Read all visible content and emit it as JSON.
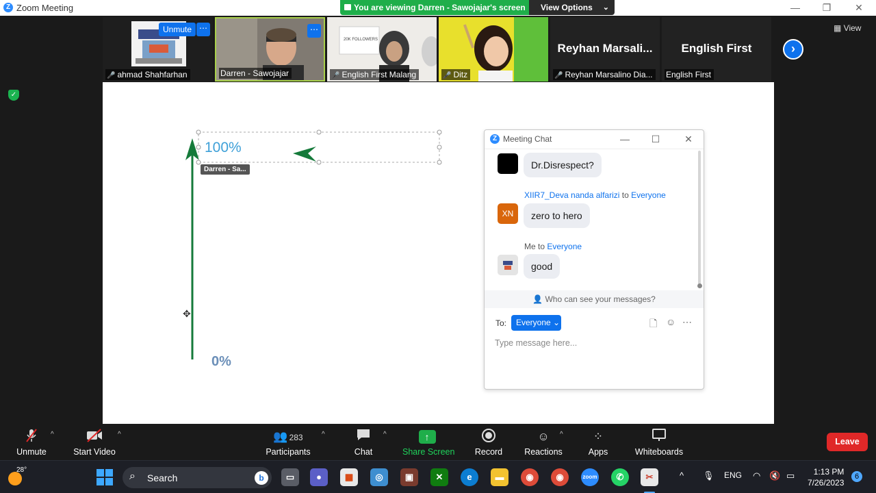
{
  "window": {
    "title": "Zoom Meeting",
    "minimize": "—",
    "restore": "❐",
    "close": "✕"
  },
  "banner": {
    "viewing_text": "You are viewing Darren - Sawojajar's screen",
    "view_options": "View Options"
  },
  "thumbnails": [
    {
      "name": "ahmad Shahfarhan",
      "muted": true,
      "unmute_label": "Unmute"
    },
    {
      "name": "Darren - Sawojajar",
      "muted": false
    },
    {
      "name": "English First Malang",
      "muted": true
    },
    {
      "name": "Ditz",
      "muted": true
    },
    {
      "name": "Reyhan Marsalino Dia...",
      "muted": true,
      "display_name": "Reyhan  Marsali..."
    },
    {
      "name": "English First",
      "muted": false,
      "display_name": "English First"
    }
  ],
  "thumb_overlay": {
    "followers_text": "20K FOLLOWERS"
  },
  "strip": {
    "view_label": "View"
  },
  "share": {
    "top_label": "100%",
    "bottom_label": "0%",
    "annotator_tag": "Darren - Sa..."
  },
  "chat": {
    "title": "Meeting Chat",
    "messages": [
      {
        "text": "Dr.Disrespect?"
      },
      {
        "sender": "XIIR7_Deva nanda alfarizi",
        "to_word": "to",
        "recipient": "Everyone",
        "avatar_initials": "XN",
        "text": "zero to hero"
      },
      {
        "sender": "Me",
        "to_word": "to",
        "recipient": "Everyone",
        "text": "good"
      }
    ],
    "who_can_see": "Who can see your messages?",
    "to_label": "To:",
    "to_value": "Everyone",
    "placeholder": "Type message here..."
  },
  "toolbar": {
    "unmute": "Unmute",
    "start_video": "Start Video",
    "participants": "Participants",
    "participants_count": "283",
    "chat": "Chat",
    "share_screen": "Share Screen",
    "record": "Record",
    "reactions": "Reactions",
    "apps": "Apps",
    "whiteboards": "Whiteboards",
    "leave": "Leave"
  },
  "taskbar": {
    "temperature": "28°",
    "search": "Search",
    "zoom_app_label": "zoom",
    "language": "ENG",
    "time": "1:13 PM",
    "date": "7/26/2023",
    "notifications": "6"
  },
  "colors": {
    "zoom_blue": "#0e72ed",
    "green": "#1fae4a",
    "leave_red": "#e02828",
    "arrow_green": "#157a3a"
  },
  "icons": [
    "mic-muted-icon",
    "video-off-icon",
    "participants-icon",
    "chat-icon",
    "share-screen-icon",
    "record-icon",
    "reactions-icon",
    "apps-icon",
    "whiteboard-icon",
    "shield-icon",
    "search-icon"
  ]
}
